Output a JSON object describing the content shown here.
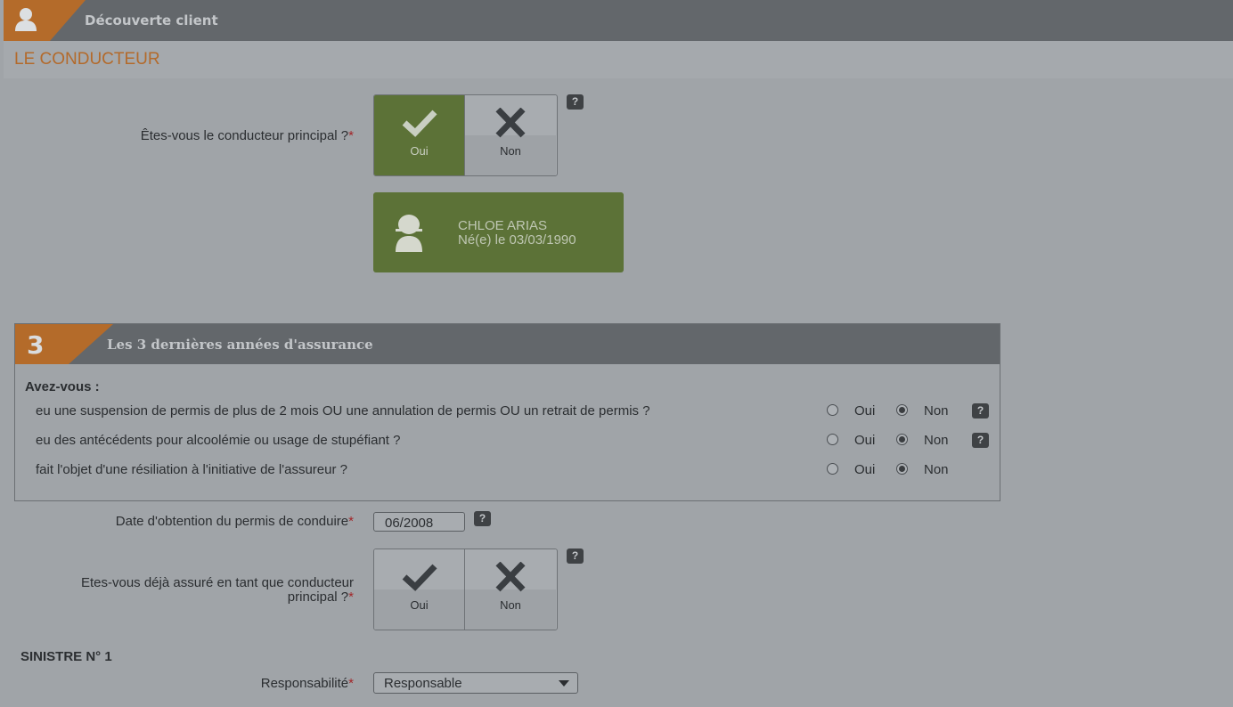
{
  "header": {
    "title": "Découverte client",
    "icon": "user-icon",
    "accent_color": "#b46b2a"
  },
  "conducteur": {
    "section_title": "LE CONDUCTEUR"
  },
  "principal_question": {
    "label": "Êtes-vous le conducteur principal ?",
    "required_mark": "*",
    "options": [
      {
        "label": "Oui",
        "icon": "check-icon",
        "selected": true
      },
      {
        "label": "Non",
        "icon": "cross-icon",
        "selected": false
      }
    ],
    "help": "?"
  },
  "person": {
    "name": "CHLOE ARIAS",
    "birth": "Né(e) le 03/03/1990"
  },
  "section3": {
    "number": "3",
    "title": "Les 3 dernières années d'assurance",
    "intro": "Avez-vous :",
    "questions": [
      {
        "text": "eu une suspension de permis de plus de 2 mois OU une annulation de permis OU un retrait de permis ?",
        "yes_label": "Oui",
        "no_label": "Non",
        "value": "Non",
        "help": "?"
      },
      {
        "text": "eu des antécédents pour alcoolémie ou usage de stupéfiant ?",
        "yes_label": "Oui",
        "no_label": "Non",
        "value": "Non",
        "help": "?"
      },
      {
        "text": "fait l'objet d'une résiliation à l'initiative de l'assureur ?",
        "yes_label": "Oui",
        "no_label": "Non",
        "value": "Non"
      }
    ]
  },
  "permis": {
    "label": "Date d'obtention du permis de conduire",
    "required_mark": "*",
    "value": "06/2008",
    "help": "?"
  },
  "assure_question": {
    "label_line1": "Etes-vous déjà assuré en tant que conducteur",
    "label_line2": "principal ?",
    "required_mark": "*",
    "options": [
      {
        "label": "Oui",
        "icon": "check-icon",
        "selected": false
      },
      {
        "label": "Non",
        "icon": "cross-icon",
        "selected": false
      }
    ],
    "help": "?"
  },
  "sinistre": {
    "title": "SINISTRE N° 1",
    "responsabilite_label": "Responsabilité",
    "required_mark": "*",
    "responsabilite_value": "Responsable"
  }
}
